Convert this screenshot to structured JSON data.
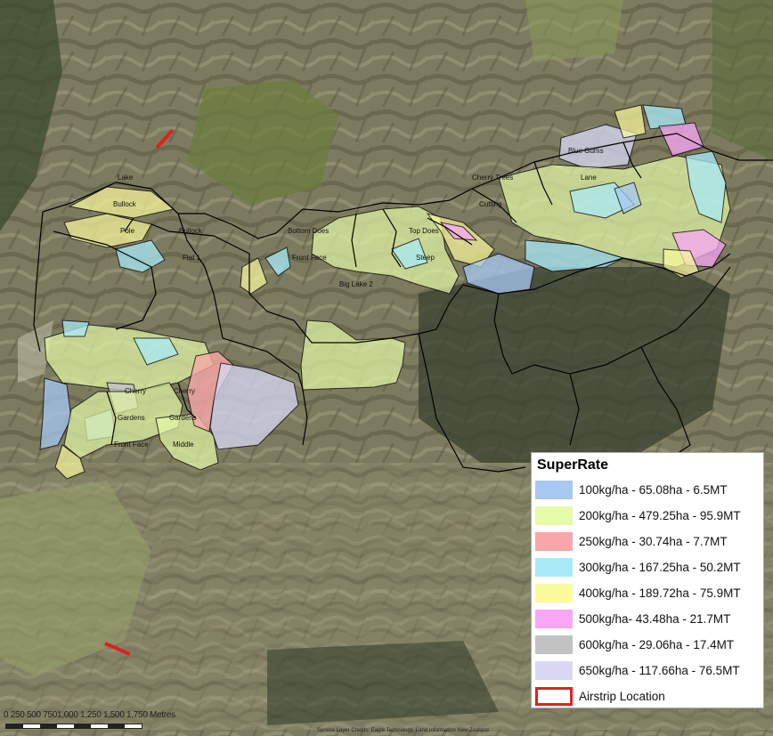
{
  "legend": {
    "title": "SuperRate",
    "items": [
      {
        "label": "100kg/ha - 65.08ha - 6.5MT",
        "color": "#a6c8f3"
      },
      {
        "label": "200kg/ha - 479.25ha - 95.9MT",
        "color": "#e6fba7"
      },
      {
        "label": "250kg/ha - 30.74ha - 7.7MT",
        "color": "#f7a7a8"
      },
      {
        "label": "300kg/ha - 167.25ha - 50.2MT",
        "color": "#a8ebf8"
      },
      {
        "label": "400kg/ha - 189.72ha - 75.9MT",
        "color": "#fbfb9c"
      },
      {
        "label": "500kg/ha- 43.48ha - 21.7MT",
        "color": "#f8a6f5"
      },
      {
        "label": "600kg/ha - 29.06ha - 17.4MT",
        "color": "#c2c2c2"
      },
      {
        "label": "650kg/ha - 117.66ha - 76.5MT",
        "color": "#d8d8f5"
      },
      {
        "label": "Airstrip Location",
        "color": "#e02020"
      }
    ]
  },
  "paddock_labels": {
    "lake": "Lake",
    "bullock_w": "Bullock",
    "bullock_e": "Bullock",
    "pole": "Pole",
    "flat1": "Flat 1",
    "bottom_does": "Bottom Does",
    "front_face_n": "Front Face",
    "big_lake2": "Big Lake 2",
    "top_does": "Top Does",
    "steep": "Steep",
    "cutting": "Cutting",
    "cherry_trees": "Cherry Trees",
    "lane": "Lane",
    "blue_gums": "Blue Gums",
    "cherry_w": "Cherry",
    "cherry_e": "Cherry",
    "gardens_w": "Gardens",
    "gardens_e": "Gardens",
    "front_face_s": "Front Face",
    "middle": "Middle"
  },
  "scale": {
    "label": "0  250 500 7501,000 1,250 1,500 1,750 Metres"
  },
  "credits": "Service Layer Credits: Eagle Technology, Land Information New Zealand",
  "colors": {
    "boundary": "#000000",
    "airstrip": "#e02020"
  }
}
